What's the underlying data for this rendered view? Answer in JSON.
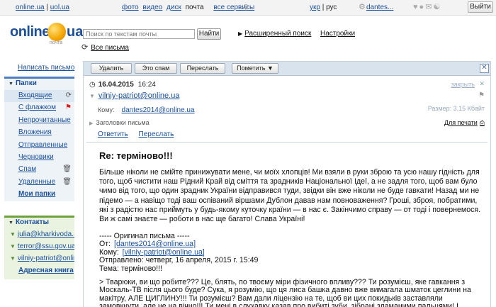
{
  "topbar": {
    "site1": "online.ua",
    "site_sep": " | ",
    "site2": "uol.ua",
    "services": [
      "фото",
      "видео",
      "диск",
      "почта"
    ],
    "all_services": "все сервисы",
    "lang_ukr": "укр",
    "lang_sep": " | ",
    "lang_rus": "рус",
    "user": "dantes...",
    "exit_label": "Выйти"
  },
  "header": {
    "logo_text": "online",
    "logo_ua": "ua",
    "logo_sub": "почта",
    "search_placeholder": "Поиск по текстам почты",
    "find_label": "Найти",
    "adv_search": "Расширенный поиск",
    "settings": "Настройки",
    "all_mail": "Все письма"
  },
  "sidebar": {
    "write": "Написать письмо",
    "folders_title": "Папки",
    "folders": [
      {
        "label": "Входящие"
      },
      {
        "label": "С флажком"
      },
      {
        "label": "Непрочитанные"
      },
      {
        "label": "Вложения"
      },
      {
        "label": "Отправленные"
      },
      {
        "label": "Черновики"
      },
      {
        "label": "Спам"
      },
      {
        "label": "Удаленные"
      }
    ],
    "my_folders": "Мои папки",
    "contacts_title": "Контакты",
    "contacts": [
      {
        "label": "julia@kharkivoda..."
      },
      {
        "label": "terror@ssu.gov.ua"
      },
      {
        "label": "vilniy-patriot@online.ua"
      }
    ],
    "address_book": "Адресная книга"
  },
  "toolbar": {
    "delete": "Удалить",
    "spam": "Это спам",
    "forward": "Переслать",
    "mark": "Пометить ▼"
  },
  "message": {
    "date": "16.04.2015",
    "time": "16:24",
    "close_link": "закрыть",
    "from": "vilniy-patriot@online.ua",
    "to_label": "Кому:",
    "to": "dantes2014@online.ua",
    "size": "Размер: 3.15 Кбайт",
    "headers_link": "Заголовки письма",
    "print": "Для печати",
    "reply": "Ответить",
    "forward": "Переслать",
    "subject": "Re: терміново!!!",
    "body": "Більше ніколи не смійте принижувати мене, чи моїх хлопців! Ми взяли в руки зброю та усю нашу гідність для того, щоб чистити наш Рідний Край від сміття та зрадників Національної Ідеї, а не задля того, щоб вам було чимо від того, що один зрадник України відправився туди, звідки він вже ніколи не буде гавкати! Назад ми не підемо — а навіщо тоді ваш оспіваний віршами Дублон давав нам повноваження? Гроші, зброя, побратими, які з радістю нас приймуть у будь-якому куточку країни — в нас є. Закінчимо справу — от тоді і повернемося. Ви ж самі знаєте — роботи в нас ще багато! Слава Україні!",
    "original_title": "----- Оригинал письма -----",
    "orig_from_label": "От:",
    "orig_from": "[dantes2014@online.ua]",
    "orig_to_label": "Кому:",
    "orig_to": "[vilniy-patriot@online.ua]",
    "orig_sent": "Отправлено: четверг, 16 апреля, 2015 г. 15:49",
    "orig_subject": "Тема: терміново!!!",
    "quoted": "> Тварюки, ви що робите??? Це, блять, по твоєму міри фізичного впливу??? Ти розумієш, яке гавкання з Москаль-ТВ після цього буде? Сука, я розумію, що ця лиса башка давно вже вимагала шматок цеглини на макітру, АЛЕ ЦИГЛИНУ!!! Ти розумієш? Вам дали ліцензію на те, щоб ви цих покидьків заставляли замовкнути, але не на вічно!!! Ти мені в слухавку казав про вибиті зуби, зібрані зламаними пальцями! І стосовно подальшої долі ваших"
  }
}
